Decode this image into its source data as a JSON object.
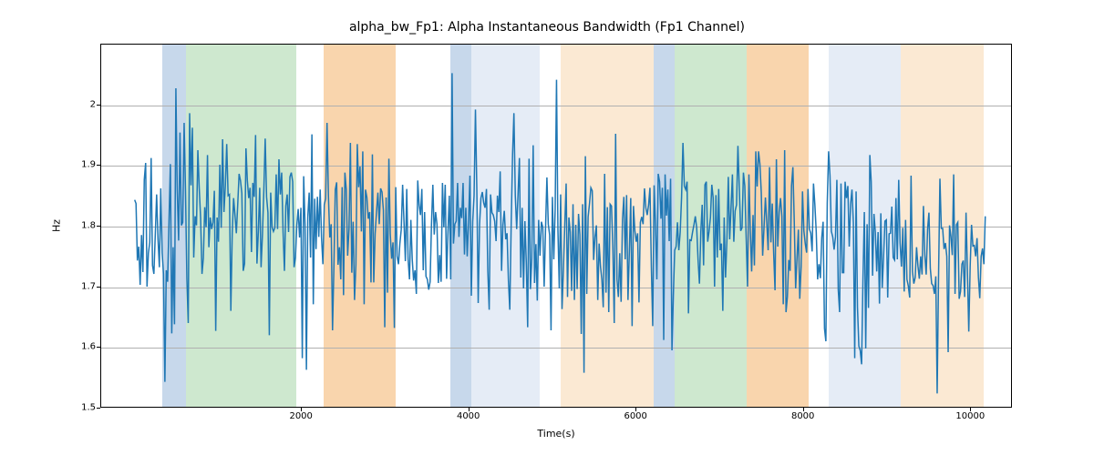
{
  "chart_data": {
    "type": "line",
    "title": "alpha_bw_Fp1: Alpha Instantaneous Bandwidth (Fp1 Channel)",
    "xlabel": "Time(s)",
    "ylabel": "Hz",
    "xlim": [
      -400,
      10500
    ],
    "ylim": [
      1.5,
      2.1
    ],
    "x_ticks": [
      2000,
      4000,
      6000,
      8000,
      10000
    ],
    "y_ticks": [
      1.5,
      1.6,
      1.7,
      1.8,
      1.9,
      2.0
    ],
    "grid_y": true,
    "bands": [
      {
        "start": 329,
        "end": 616,
        "color": "#c7d8eb"
      },
      {
        "start": 616,
        "end": 1931,
        "color": "#cee8cf"
      },
      {
        "start": 2260,
        "end": 3123,
        "color": "#f9d5ad"
      },
      {
        "start": 3780,
        "end": 4027,
        "color": "#c7d8eb"
      },
      {
        "start": 4027,
        "end": 4848,
        "color": "#e5ecf6"
      },
      {
        "start": 5095,
        "end": 6205,
        "color": "#fbe9d3"
      },
      {
        "start": 6205,
        "end": 6451,
        "color": "#c7d8eb"
      },
      {
        "start": 6451,
        "end": 7314,
        "color": "#cee8cf"
      },
      {
        "start": 7314,
        "end": 8054,
        "color": "#f9d5ad"
      },
      {
        "start": 8300,
        "end": 9163,
        "color": "#e5ecf6"
      },
      {
        "start": 9163,
        "end": 10150,
        "color": "#fbe9d3"
      }
    ],
    "series": [
      {
        "name": "alpha_bw_Fp1",
        "color": "#1f77b4",
        "x_start": 0,
        "x_step": 16.43,
        "y": [
          1.844,
          1.838,
          1.744,
          1.767,
          1.704,
          1.786,
          1.725,
          1.877,
          1.905,
          1.701,
          1.756,
          1.774,
          1.913,
          1.736,
          1.722,
          1.786,
          1.853,
          1.779,
          1.733,
          1.863,
          1.757,
          1.722,
          1.544,
          1.728,
          1.709,
          1.809,
          1.903,
          1.624,
          1.766,
          1.639,
          2.028,
          1.859,
          1.777,
          1.955,
          1.802,
          1.807,
          1.971,
          1.859,
          1.714,
          1.641,
          1.987,
          1.868,
          1.963,
          1.749,
          1.817,
          1.802,
          1.926,
          1.863,
          1.814,
          1.722,
          1.748,
          1.832,
          1.799,
          1.918,
          1.766,
          1.815,
          1.796,
          1.807,
          1.859,
          1.628,
          1.815,
          1.775,
          1.902,
          1.798,
          1.944,
          1.824,
          1.867,
          1.936,
          1.851,
          1.853,
          1.661,
          1.789,
          1.847,
          1.819,
          1.789,
          1.836,
          1.887,
          1.876,
          1.855,
          1.727,
          1.739,
          1.929,
          1.876,
          1.847,
          1.864,
          1.758,
          1.872,
          1.849,
          1.951,
          1.739,
          1.791,
          1.864,
          1.733,
          1.787,
          1.859,
          1.945,
          1.849,
          1.823,
          1.621,
          1.856,
          1.799,
          1.792,
          1.798,
          1.886,
          1.796,
          1.911,
          1.853,
          1.889,
          1.792,
          1.727,
          1.834,
          1.853,
          1.791,
          1.882,
          1.889,
          1.874,
          1.733,
          1.749,
          1.802,
          1.829,
          1.782,
          1.831,
          1.583,
          1.883,
          1.802,
          1.564,
          1.816,
          1.856,
          1.749,
          1.952,
          1.672,
          1.846,
          1.763,
          1.849,
          1.783,
          1.861,
          1.781,
          1.738,
          1.836,
          1.846,
          1.971,
          1.851,
          1.782,
          1.804,
          1.629,
          1.734,
          1.861,
          1.873,
          1.737,
          1.766,
          1.713,
          1.865,
          1.687,
          1.889,
          1.861,
          1.752,
          1.796,
          1.938,
          1.724,
          1.808,
          1.679,
          1.737,
          1.936,
          1.865,
          1.899,
          1.792,
          1.924,
          1.672,
          1.861,
          1.848,
          1.813,
          1.824,
          1.708,
          1.919,
          1.708,
          1.788,
          1.824,
          1.856,
          1.804,
          1.863,
          1.857,
          1.827,
          1.634,
          1.848,
          1.691,
          1.912,
          1.788,
          1.747,
          1.774,
          1.633,
          1.865,
          1.751,
          1.738,
          1.772,
          1.795,
          1.869,
          1.808,
          1.743,
          1.862,
          1.746,
          1.713,
          1.811,
          1.746,
          1.711,
          1.728,
          1.689,
          1.876,
          1.836,
          1.819,
          1.862,
          1.728,
          1.824,
          1.718,
          1.713,
          1.696,
          1.709,
          1.803,
          1.869,
          1.787,
          1.824,
          1.804,
          1.707,
          1.753,
          1.709,
          1.872,
          1.799,
          1.869,
          1.714,
          1.792,
          1.851,
          1.713,
          2.053,
          1.772,
          1.804,
          1.809,
          1.872,
          1.783,
          1.831,
          1.814,
          1.872,
          1.754,
          1.831,
          1.751,
          1.808,
          1.884,
          1.686,
          1.808,
          1.851,
          1.993,
          1.862,
          1.674,
          1.804,
          1.847,
          1.857,
          1.839,
          1.831,
          1.862,
          1.727,
          1.663,
          1.853,
          1.823,
          1.819,
          1.809,
          1.776,
          1.851,
          1.824,
          1.891,
          1.727,
          1.803,
          1.826,
          1.779,
          1.789,
          1.711,
          1.663,
          1.803,
          1.918,
          1.987,
          1.851,
          1.796,
          1.853,
          1.913,
          1.716,
          1.831,
          1.698,
          1.809,
          1.741,
          1.634,
          1.912,
          1.697,
          1.747,
          1.934,
          1.707,
          1.771,
          1.678,
          1.811,
          1.752,
          1.808,
          1.799,
          1.701,
          1.796,
          1.881,
          1.804,
          1.786,
          1.629,
          1.849,
          1.746,
          1.828,
          2.042,
          1.796,
          1.698,
          1.853,
          1.664,
          1.729,
          1.802,
          1.871,
          1.684,
          1.815,
          1.791,
          1.694,
          1.837,
          1.679,
          1.803,
          1.697,
          1.821,
          1.787,
          1.623,
          1.837,
          1.559,
          1.916,
          1.689,
          1.816,
          1.838,
          1.864,
          1.859,
          1.745,
          1.783,
          1.802,
          1.679,
          1.772,
          1.734,
          1.713,
          1.667,
          1.887,
          1.691,
          1.832,
          1.659,
          1.837,
          1.834,
          1.765,
          1.641,
          1.953,
          1.713,
          1.684,
          1.756,
          1.676,
          1.812,
          1.849,
          1.746,
          1.852,
          1.679,
          1.759,
          1.847,
          1.636,
          1.834,
          1.793,
          1.775,
          1.789,
          1.675,
          1.807,
          1.816,
          1.804,
          1.863,
          1.831,
          1.819,
          1.836,
          1.864,
          1.734,
          1.636,
          1.868,
          1.804,
          1.713,
          1.887,
          1.874,
          1.813,
          1.864,
          1.613,
          1.886,
          1.818,
          1.861,
          1.776,
          1.879,
          1.596,
          1.686,
          1.761,
          1.767,
          1.807,
          1.761,
          1.791,
          1.849,
          1.938,
          1.867,
          1.861,
          1.874,
          1.657,
          1.778,
          1.777,
          1.791,
          1.803,
          1.817,
          1.798,
          1.745,
          1.706,
          1.791,
          1.836,
          1.736,
          1.869,
          1.874,
          1.775,
          1.792,
          1.815,
          1.869,
          1.847,
          1.701,
          1.852,
          1.749,
          1.862,
          1.761,
          1.772,
          1.661,
          1.815,
          1.716,
          1.779,
          1.882,
          1.779,
          1.831,
          1.886,
          1.775,
          1.826,
          1.836,
          1.933,
          1.863,
          1.793,
          1.798,
          1.889,
          1.867,
          1.783,
          1.701,
          1.886,
          1.793,
          1.726,
          1.819,
          1.736,
          1.924,
          1.866,
          1.924,
          1.903,
          1.856,
          1.752,
          1.799,
          1.848,
          1.807,
          1.761,
          1.898,
          1.774,
          1.838,
          1.757,
          1.695,
          1.911,
          1.767,
          1.824,
          1.847,
          1.817,
          1.672,
          1.926,
          1.659,
          1.684,
          1.745,
          1.727,
          1.867,
          1.898,
          1.808,
          1.698,
          1.748,
          1.795,
          1.681,
          1.734,
          1.858,
          1.793,
          1.772,
          1.757,
          1.862,
          1.796,
          1.789,
          1.759,
          1.871,
          1.836,
          1.791,
          1.713,
          1.738,
          1.715,
          1.782,
          1.808,
          1.632,
          1.611,
          1.839,
          1.924,
          1.884,
          1.792,
          1.783,
          1.762,
          1.783,
          1.877,
          1.696,
          1.659,
          1.871,
          1.724,
          1.724,
          1.874,
          1.847,
          1.867,
          1.767,
          1.837,
          1.861,
          1.806,
          1.583,
          1.858,
          1.667,
          1.603,
          1.596,
          1.573,
          1.714,
          1.824,
          1.599,
          1.804,
          1.666,
          1.918,
          1.874,
          1.719,
          1.821,
          1.791,
          1.726,
          1.791,
          1.673,
          1.822,
          1.699,
          1.751,
          1.809,
          1.811,
          1.683,
          1.788,
          1.789,
          1.833,
          1.749,
          1.745,
          1.847,
          1.746,
          1.877,
          1.773,
          1.734,
          1.798,
          1.693,
          1.811,
          1.713,
          1.702,
          1.683,
          1.884,
          1.726,
          1.706,
          1.716,
          1.766,
          1.735,
          1.714,
          1.751,
          1.721,
          1.834,
          1.753,
          1.721,
          1.795,
          1.823,
          1.731,
          1.706,
          1.703,
          1.689,
          1.718,
          1.525,
          1.718,
          1.879,
          1.797,
          1.797,
          1.763,
          1.773,
          1.751,
          1.593,
          1.802,
          1.784,
          1.753,
          1.886,
          1.689,
          1.803,
          1.807,
          1.681,
          1.693,
          1.738,
          1.744,
          1.684,
          1.823,
          1.727,
          1.627,
          1.734,
          1.803,
          1.768,
          1.769,
          1.751,
          1.781,
          1.717,
          1.682,
          1.751,
          1.764,
          1.738,
          1.817
        ]
      }
    ]
  }
}
